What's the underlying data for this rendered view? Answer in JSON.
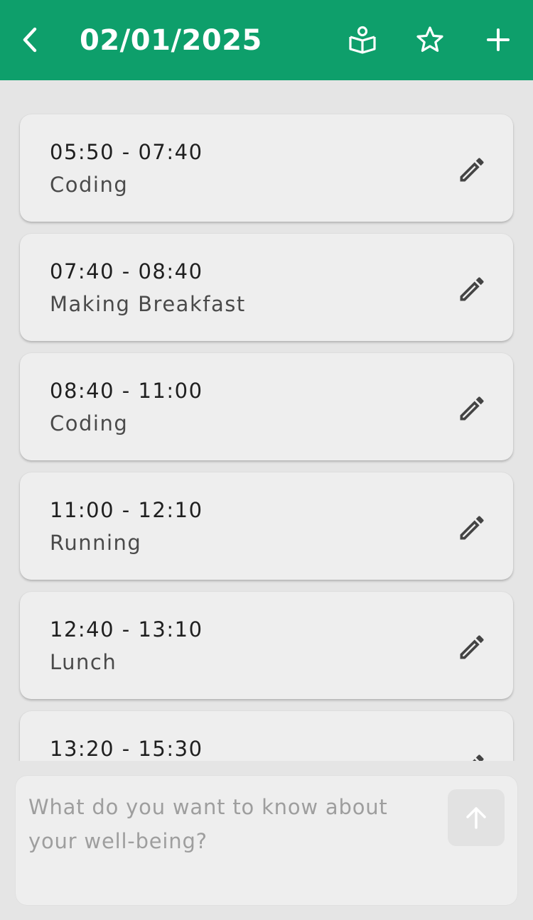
{
  "header": {
    "title": "02/01/2025",
    "background_color": "#0e9f6b",
    "icons": {
      "back": "chevron-left-icon",
      "learn": "book-person-icon",
      "favorite": "star-outline-icon",
      "add": "plus-icon"
    }
  },
  "entries": [
    {
      "time": "05:50 - 07:40",
      "activity": "Coding"
    },
    {
      "time": "07:40 - 08:40",
      "activity": "Making Breakfast"
    },
    {
      "time": "08:40 - 11:00",
      "activity": "Coding"
    },
    {
      "time": "11:00 - 12:10",
      "activity": "Running"
    },
    {
      "time": "12:40 - 13:10",
      "activity": "Lunch"
    },
    {
      "time": "13:20 - 15:30",
      "activity": ""
    }
  ],
  "chat": {
    "placeholder": "What do you want to know about your well-being?",
    "value": "",
    "send_icon": "arrow-up-icon"
  }
}
